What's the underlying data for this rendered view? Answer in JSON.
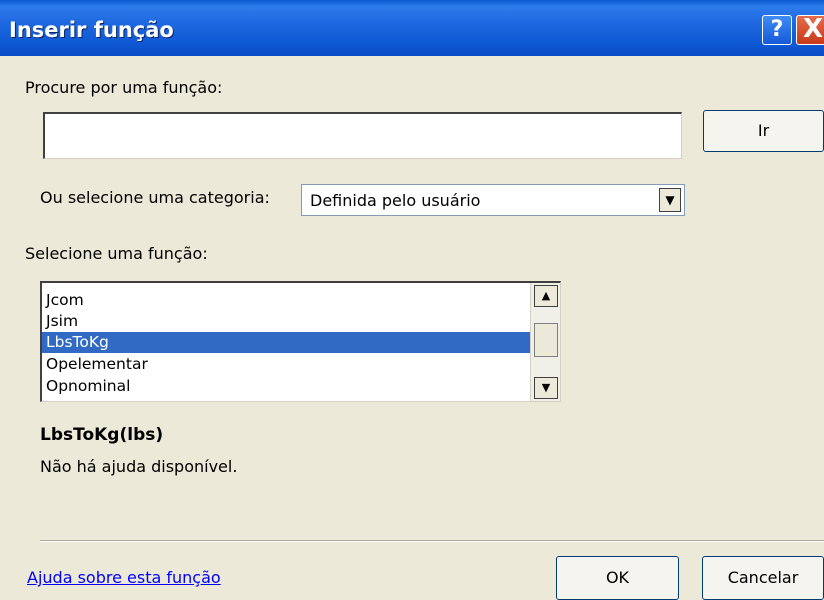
{
  "window": {
    "title": "Inserir função",
    "help_glyph": "?",
    "close_glyph": "X"
  },
  "search": {
    "label": "Procure por uma função:",
    "value": "",
    "go_label": "Ir"
  },
  "category": {
    "label": "Ou selecione uma categoria:",
    "selected": "Definida pelo usuário"
  },
  "functions": {
    "label": "Selecione uma função:",
    "items": [
      "Jcom",
      "Jsim",
      "LbsToKg",
      "Opelementar",
      "Opnominal"
    ],
    "selected_index": 2
  },
  "details": {
    "signature": "LbsToKg(lbs)",
    "description": "Não há ajuda disponível."
  },
  "footer": {
    "help_link": "Ajuda sobre esta função",
    "ok_label": "OK",
    "cancel_label": "Cancelar"
  },
  "colors": {
    "titlebar": "#0A5ACF",
    "selection": "#316AC5",
    "dialog_bg": "#ECE9D8",
    "link": "#0000FF"
  }
}
